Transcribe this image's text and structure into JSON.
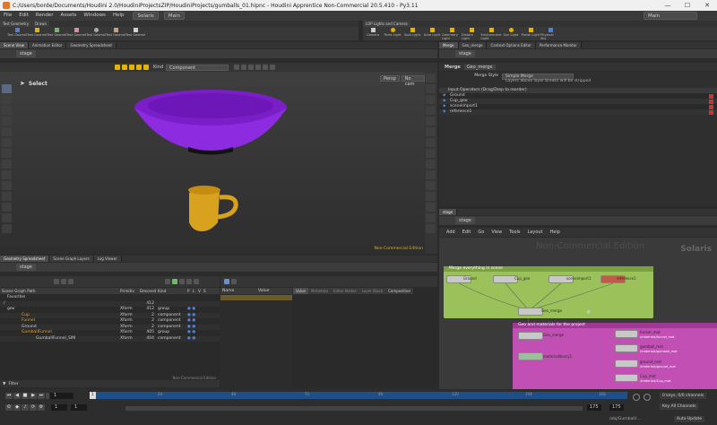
{
  "titlebar": {
    "title": "C:/Users/borde/Documents/Houdini 2.0/HoudiniProjectsZIP/HoudiniProjects/gumballs_01.hipnc - Houdini Apprentice Non-Commercial 20.5.410 - Py3.11",
    "minimize": "—",
    "maximize": "☐",
    "close": "✕"
  },
  "menubar": {
    "items": [
      "File",
      "Edit",
      "Render",
      "Assets",
      "Windows",
      "Help"
    ],
    "desktop": "Solaris",
    "context": "Main",
    "right_desktop": "Main"
  },
  "shelf": {
    "tabs_left": [
      "Test Geometry",
      "Drawn"
    ],
    "tools_left": [
      "Test Geometry: Rubber Toy",
      "Test Geometry: Squab",
      "Test Geometry: Crag",
      "Test Geometry: Pig Head",
      "Test Geometry: Shader Ball",
      "Test Geometry: Tommy",
      "Test Geometry: Template"
    ],
    "tabs_right": [
      "LOP Lights and Camera"
    ],
    "tools_right": [
      "Camera",
      "Point Light",
      "Spot Light",
      "Area Light",
      "Geometry Light",
      "Distant Light",
      "Environment Light",
      "Sun Light",
      "Portal Light",
      "Physical Sky"
    ]
  },
  "viewport": {
    "tabs": [
      "Scene View",
      "Animation Editor",
      "Geometry Spreadsheet"
    ],
    "path": "stage",
    "select_label": "Select",
    "kind_label": "Kind",
    "kind_value": "Component",
    "camera_persp": "Persp",
    "camera_cam": "No cam",
    "watermark": "Non-Commercial Edition"
  },
  "scenegraph": {
    "tabs": [
      "Geometry Spreadsheet",
      "Scene Graph Layers",
      "Log Viewer"
    ],
    "path": "stage",
    "columns": [
      "Scene Graph Path",
      "Primitiv",
      "Descend",
      "Kind",
      "P",
      "L",
      "V",
      "S"
    ],
    "rows": [
      {
        "name": "Favorites",
        "prim": "",
        "desc": "",
        "kind": ""
      },
      {
        "name": "/",
        "prim": "",
        "desc": "412",
        "kind": ""
      },
      {
        "name": "geo",
        "prim": "Xform",
        "desc": "412",
        "kind": "group"
      },
      {
        "name": "Cup",
        "prim": "Xform",
        "desc": "2",
        "kind": "component"
      },
      {
        "name": "Funnel",
        "prim": "Xform",
        "desc": "2",
        "kind": "component"
      },
      {
        "name": "Ground",
        "prim": "Xform",
        "desc": "2",
        "kind": "component"
      },
      {
        "name": "GumballFunnel",
        "prim": "Xform",
        "desc": "405",
        "kind": "group"
      },
      {
        "name": "GumballFunnel_SIM",
        "prim": "Xform",
        "desc": "404",
        "kind": "component"
      }
    ],
    "filter_label": "Filter",
    "watermark": "Non-Commercial Edition"
  },
  "primprops": {
    "columns": [
      "Name",
      "Value"
    ],
    "tabs": [
      "Value",
      "Metadata",
      "Editor Nodes",
      "Layer Stack",
      "Composition"
    ]
  },
  "params": {
    "tabs": [
      "Merge",
      "Geo_merge",
      "Context Options Editor",
      "Performance Monitor"
    ],
    "node_type": "Merge",
    "node_name": "Geo_merge",
    "merge_style_label": "Merge Style",
    "merge_style_value": "Simple Merge",
    "note": "Layers above layer breaks will be stripped",
    "inputs_header": "Input Operators (Drag/Drop to reorder)",
    "inputs": [
      "Ground",
      "Cup_geo",
      "sceneimport1",
      "reference1"
    ]
  },
  "network": {
    "tabs": [
      "stage"
    ],
    "path": "stage",
    "menu": [
      "Add",
      "Edit",
      "Go",
      "View",
      "Tools",
      "Layout",
      "Help"
    ],
    "watermark": "Non-Commercial Edition",
    "context_label": "Solaris",
    "netbox_green": "Merge everything in scene",
    "netbox_pink": "Geo and materials for the project",
    "nodes_green": [
      "Ground",
      "Cup_geo",
      "sceneimport1",
      "reference1",
      "Geo_merge"
    ],
    "nodes_pink": [
      "Geo_merge",
      "materiallibrary1",
      "funnel_mat",
      "gumball_mat",
      "ground_mat",
      "Cup_mat"
    ],
    "node_sublabels": [
      "/materials/funnel_mat",
      "/materials/gumball_mat",
      "/materials/ground_mat",
      "/materials/Cup_mat"
    ]
  },
  "timeline": {
    "ticks": [
      "1",
      "24",
      "48",
      "72",
      "96",
      "120",
      "144",
      "168"
    ],
    "frame": "1",
    "start": "1",
    "end_a": "1",
    "end_b": "175",
    "end_c": "175",
    "keys_label": "0 keys, 0/0 channels",
    "key_all": "Key All Channels",
    "auto_update": "Auto Update",
    "status_path": "/obj/Gumball/..."
  },
  "colors": {
    "bowl": "#7a1fc8",
    "cup": "#d9a21e",
    "green_box": "#9bc25a",
    "pink_box": "#c24fb3",
    "accent_blue": "#3e7bd6"
  }
}
